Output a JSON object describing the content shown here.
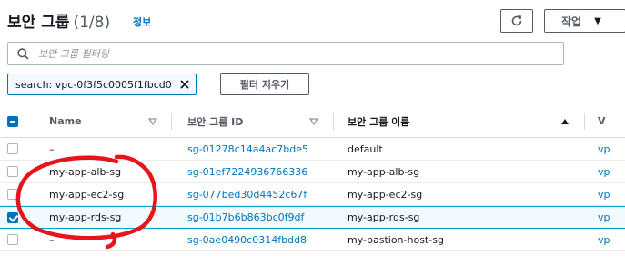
{
  "header": {
    "title": "보안 그룹",
    "count": "(1/8)",
    "info_label": "정보",
    "refresh_icon": "refresh-icon",
    "actions_label": "작업",
    "actions_icon": "caret-down-icon"
  },
  "search": {
    "placeholder": "보안 그룹 필터링",
    "icon": "search-icon"
  },
  "filter": {
    "token_text": "search: vpc-0f3f5c0005f1fbcd0",
    "token_close_icon": "close-icon",
    "clear_label": "필터 지우기"
  },
  "table": {
    "columns": {
      "name": "Name",
      "id": "보안 그룹 ID",
      "group_name": "보안 그룹 이름",
      "vpc": "V"
    },
    "rows": [
      {
        "name": "–",
        "id": "sg-01278c14a4ac7bde5",
        "group_name": "default",
        "vpc": "vp",
        "selected": false
      },
      {
        "name": "my-app-alb-sg",
        "id": "sg-01ef7224936766336",
        "group_name": "my-app-alb-sg",
        "vpc": "vp",
        "selected": false
      },
      {
        "name": "my-app-ec2-sg",
        "id": "sg-077bed30d4452c67f",
        "group_name": "my-app-ec2-sg",
        "vpc": "vp",
        "selected": false
      },
      {
        "name": "my-app-rds-sg",
        "id": "sg-01b7b6b863bc0f9df",
        "group_name": "my-app-rds-sg",
        "vpc": "vp",
        "selected": true
      },
      {
        "name": "–",
        "id": "sg-0ae0490c0314fbdd8",
        "group_name": "my-bastion-host-sg",
        "vpc": "vp",
        "selected": false
      }
    ]
  },
  "colors": {
    "link": "#0073bb",
    "selected_bg": "#f1faff",
    "annotation": "#e8141b"
  }
}
